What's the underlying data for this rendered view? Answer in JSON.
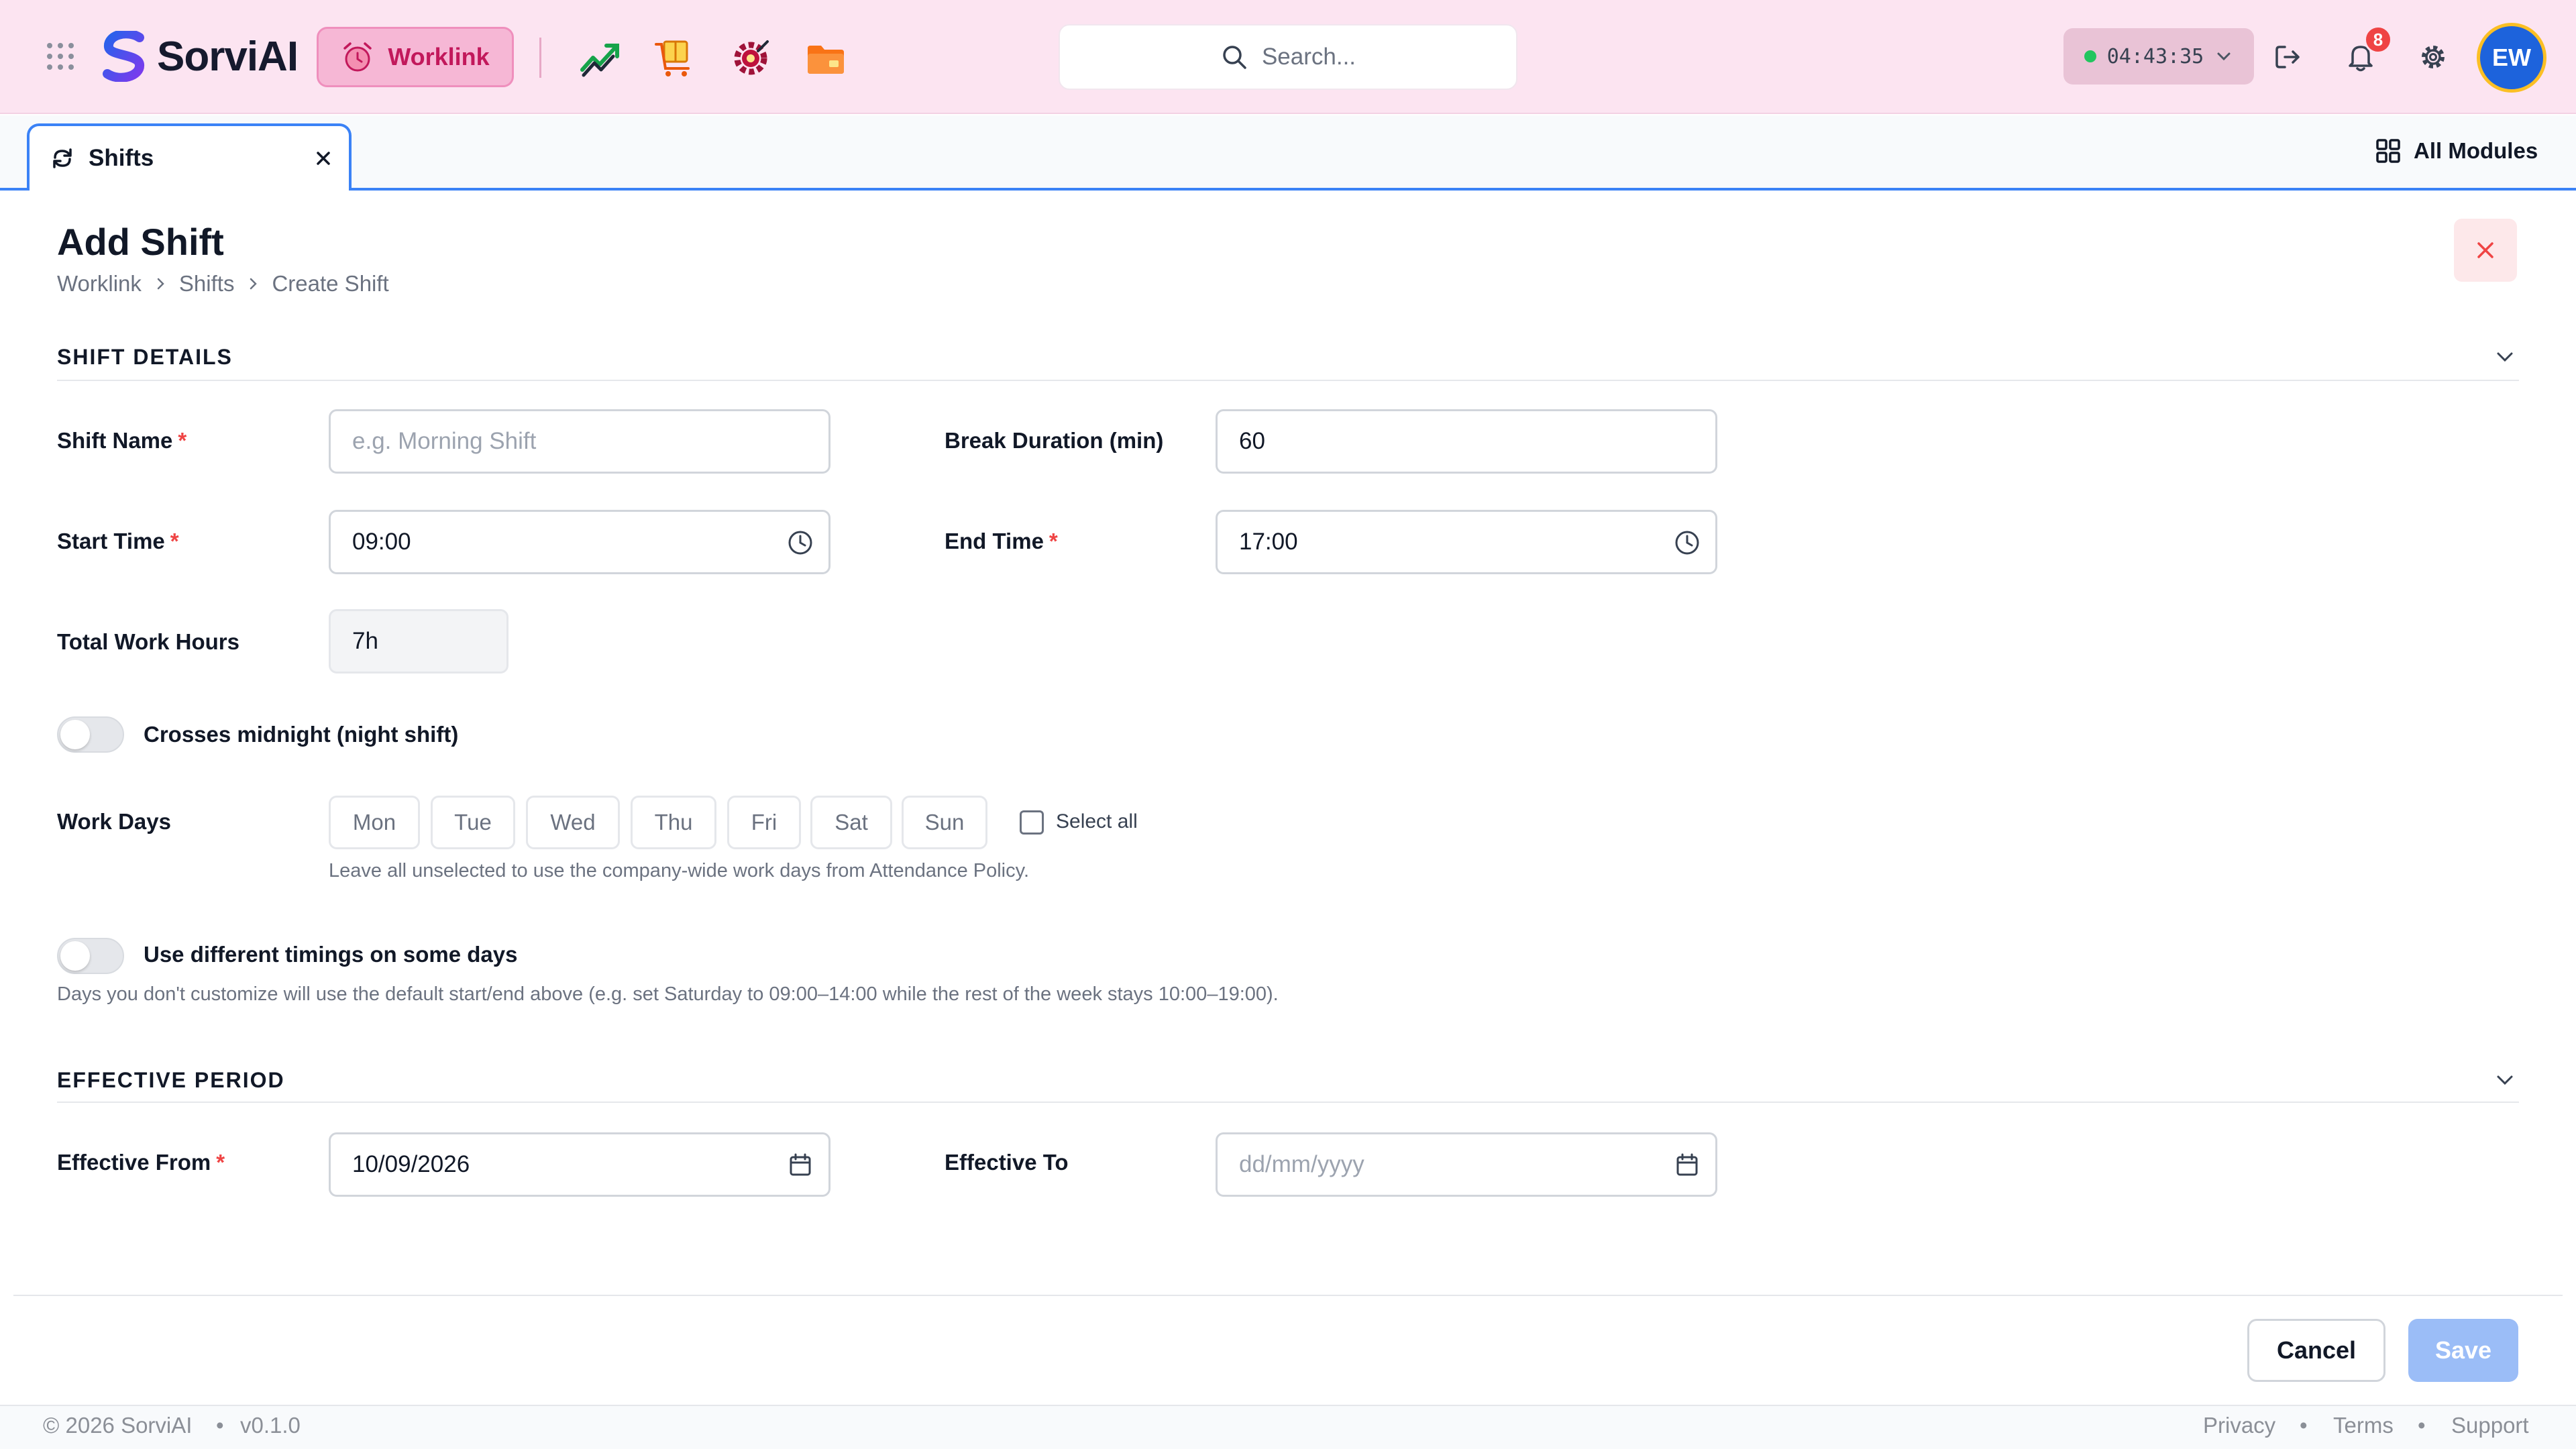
{
  "topbar": {
    "app_name": "SorviAI",
    "active_module": "Worklink",
    "search_placeholder": "Search...",
    "timer": "04:43:35",
    "notification_count": "8",
    "avatar_initials": "EW",
    "module_icons": [
      "chart-trend-icon",
      "package-cart-icon",
      "gear-target-icon",
      "folder-icon"
    ]
  },
  "tabs": {
    "active_tab": "Shifts",
    "all_modules": "All Modules"
  },
  "page": {
    "title": "Add Shift",
    "breadcrumb": [
      "Worklink",
      "Shifts",
      "Create Shift"
    ]
  },
  "shift_details": {
    "section_title": "SHIFT DETAILS",
    "shift_name_label": "Shift Name",
    "shift_name_placeholder": "e.g. Morning Shift",
    "break_label": "Break Duration (min)",
    "break_value": "60",
    "start_label": "Start Time",
    "start_value": "09:00",
    "end_label": "End Time",
    "end_value": "17:00",
    "total_label": "Total Work Hours",
    "total_value": "7h",
    "midnight_label": "Crosses midnight (night shift)",
    "workdays_label": "Work Days",
    "days": [
      "Mon",
      "Tue",
      "Wed",
      "Thu",
      "Fri",
      "Sat",
      "Sun"
    ],
    "select_all": "Select all",
    "workdays_hint": "Leave all unselected to use the company-wide work days from Attendance Policy.",
    "diff_timings_label": "Use different timings on some days",
    "diff_timings_hint": "Days you don't customize will use the default start/end above (e.g. set Saturday to 09:00–14:00 while the rest of the week stays 10:00–19:00)."
  },
  "effective_period": {
    "section_title": "EFFECTIVE PERIOD",
    "from_label": "Effective From",
    "from_value": "10/09/2026",
    "to_label": "Effective To",
    "to_placeholder": "dd/mm/yyyy"
  },
  "actions": {
    "cancel": "Cancel",
    "save": "Save"
  },
  "footer": {
    "copyright": "© 2026 SorviAI",
    "version": "v0.1.0",
    "links": [
      "Privacy",
      "Terms",
      "Support"
    ]
  },
  "colors": {
    "topbar_bg": "#fce4f1",
    "accent_blue": "#3b82f6",
    "brand_pink": "#c2185b",
    "required_red": "#ef4444"
  }
}
